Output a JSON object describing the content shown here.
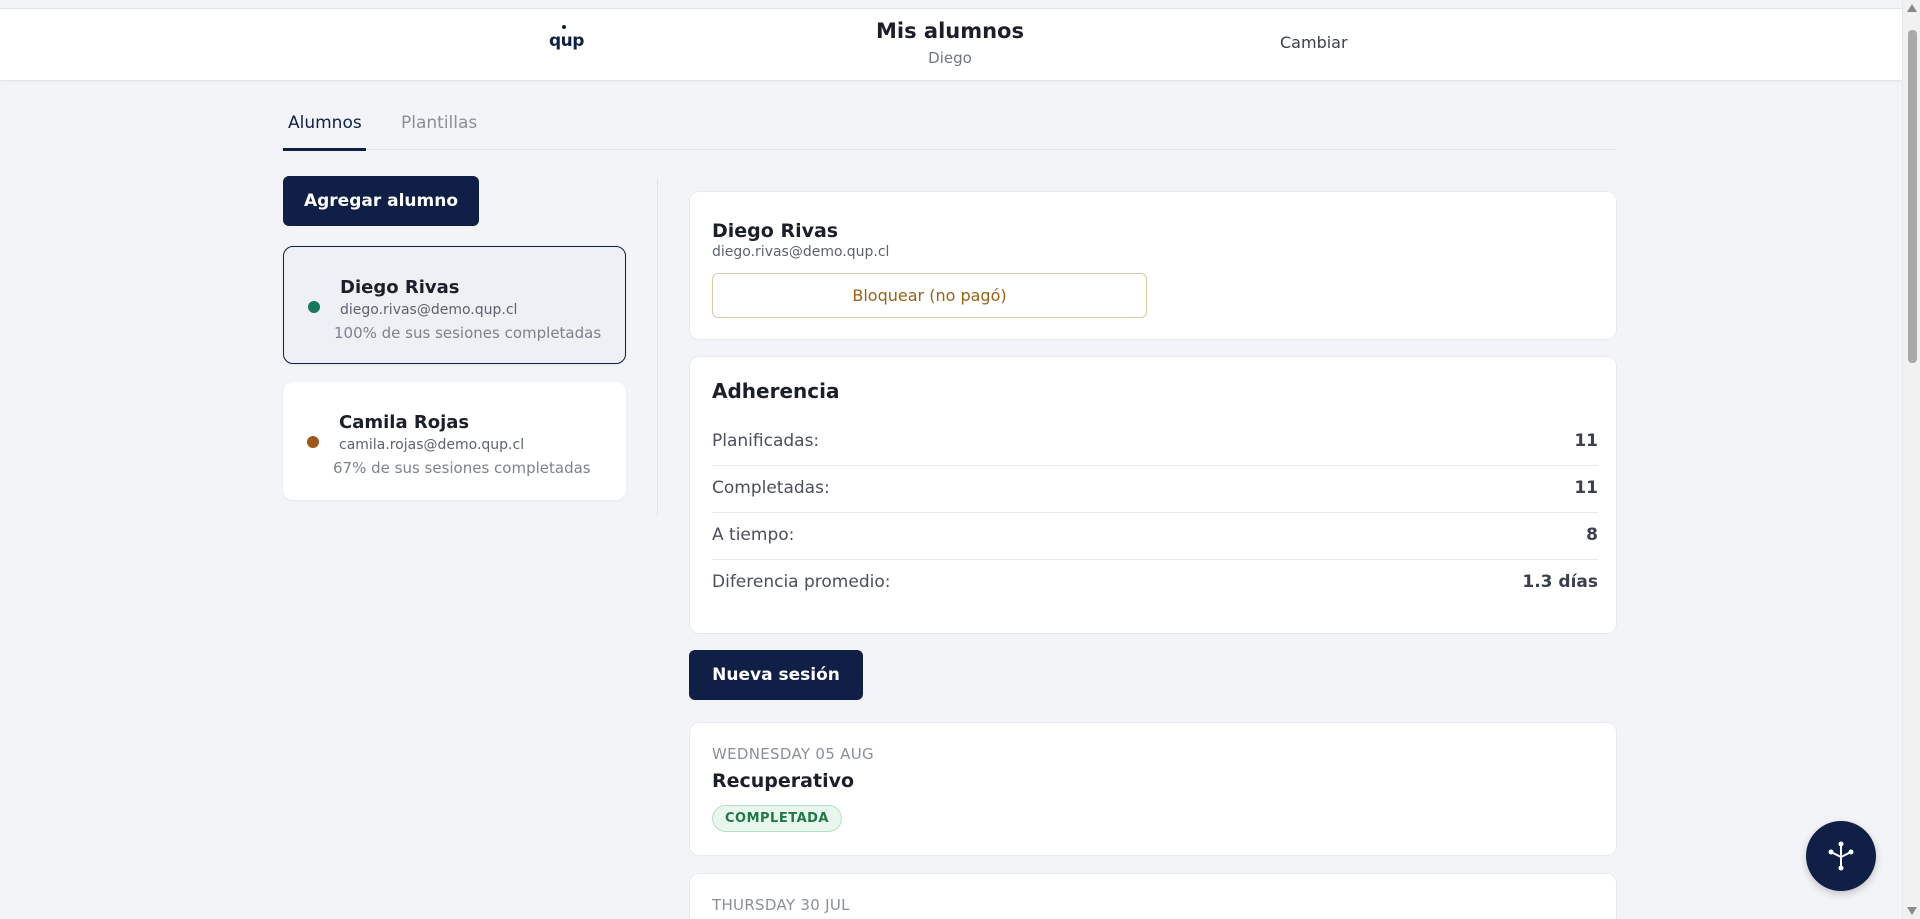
{
  "header": {
    "logo_text": "qup",
    "title": "Mis alumnos",
    "subtitle": "Diego",
    "action_label": "Cambiar"
  },
  "tabs": [
    {
      "label": "Alumnos",
      "active": true
    },
    {
      "label": "Plantillas",
      "active": false
    }
  ],
  "add_student_label": "Agregar alumno",
  "students": [
    {
      "name": "Diego Rivas",
      "email": "diego.rivas@demo.qup.cl",
      "progress": "100% de sus sesiones completadas",
      "status_color": "#17795b",
      "selected": true
    },
    {
      "name": "Camila Rojas",
      "email": "camila.rojas@demo.qup.cl",
      "progress": "67% de sus sesiones completadas",
      "status_color": "#a0571a",
      "selected": false
    }
  ],
  "profile": {
    "name": "Diego Rivas",
    "email": "diego.rivas@demo.qup.cl",
    "block_label": "Bloquear (no pagó)"
  },
  "adherence": {
    "title": "Adherencia",
    "rows": [
      {
        "label": "Planificadas:",
        "value": "11"
      },
      {
        "label": "Completadas:",
        "value": "11"
      },
      {
        "label": "A tiempo:",
        "value": "8"
      },
      {
        "label": "Diferencia promedio:",
        "value": "1.3 días"
      }
    ]
  },
  "new_session_label": "Nueva sesión",
  "sessions": [
    {
      "date": "WEDNESDAY 05 AUG",
      "title": "Recuperativo",
      "status": "COMPLETADA"
    },
    {
      "date": "THURSDAY 30 JUL",
      "title": "",
      "status": ""
    }
  ],
  "colors": {
    "primary": "#0f1f45",
    "background": "#f3f4f7",
    "success": "#1e7a45",
    "warning_text": "#9a6216"
  },
  "fab_icon": "tree-icon"
}
